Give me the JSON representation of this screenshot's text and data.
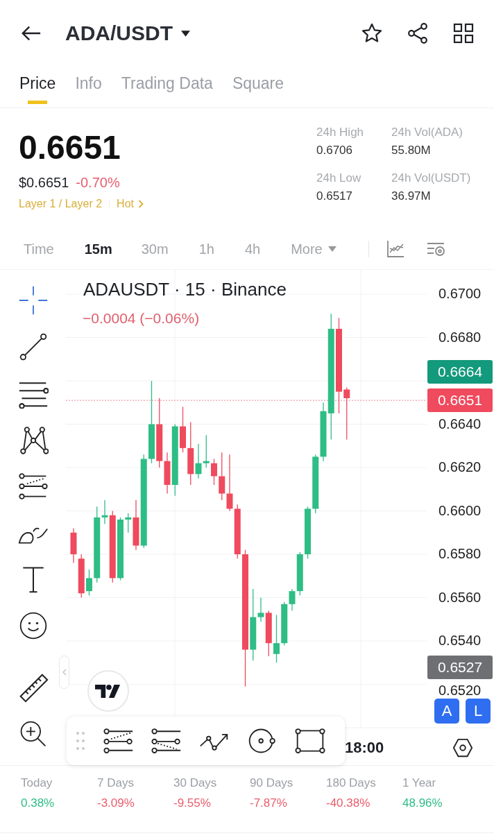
{
  "header": {
    "title": "ADA/USDT"
  },
  "tabs": [
    {
      "label": "Price",
      "selected": true
    },
    {
      "label": "Info",
      "selected": false
    },
    {
      "label": "Trading Data",
      "selected": false
    },
    {
      "label": "Square",
      "selected": false
    }
  ],
  "price": {
    "last": "0.6651",
    "usd": "$0.6651",
    "change": "-0.70%",
    "tags": [
      "Layer 1 / Layer 2",
      "Hot"
    ]
  },
  "stats": [
    {
      "label": "24h High",
      "value": "0.6706"
    },
    {
      "label": "24h Vol(ADA)",
      "value": "55.80M"
    },
    {
      "label": "24h Low",
      "value": "0.6517"
    },
    {
      "label": "24h Vol(USDT)",
      "value": "36.97M"
    }
  ],
  "intervals": [
    {
      "label": "Time",
      "selected": false
    },
    {
      "label": "15m",
      "selected": true
    },
    {
      "label": "30m",
      "selected": false
    },
    {
      "label": "1h",
      "selected": false
    },
    {
      "label": "4h",
      "selected": false
    },
    {
      "label": "More",
      "selected": false
    }
  ],
  "chart": {
    "legend": "ADAUSDT · 15 · Binance",
    "change": "−0.0004 (−0.06%)",
    "price_labels": [
      "0.6700",
      "0.6680",
      "0.6640",
      "0.6620",
      "0.6600",
      "0.6580",
      "0.6560",
      "0.6540",
      "0.6520"
    ],
    "badges": [
      {
        "value": "0.6664",
        "color": "#13997b"
      },
      {
        "value": "0.6651",
        "color": "#ef4a5d"
      },
      {
        "value": "0.6527",
        "color": "#6e6f73"
      }
    ],
    "time_label": "18:00",
    "scale_buttons": [
      "A",
      "L"
    ]
  },
  "performance": [
    {
      "label": "Today",
      "value": "0.38%",
      "color": "#2ebd85"
    },
    {
      "label": "7 Days",
      "value": "-3.09%",
      "color": "#e85d6c"
    },
    {
      "label": "30 Days",
      "value": "-9.55%",
      "color": "#e85d6c"
    },
    {
      "label": "90 Days",
      "value": "-7.87%",
      "color": "#e85d6c"
    },
    {
      "label": "180 Days",
      "value": "-40.38%",
      "color": "#e85d6c"
    },
    {
      "label": "1 Year",
      "value": "48.96%",
      "color": "#2ebd85"
    }
  ]
}
